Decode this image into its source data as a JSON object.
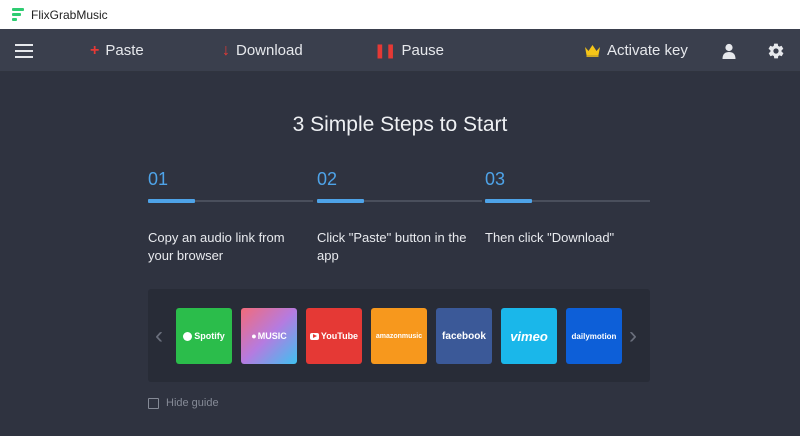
{
  "window": {
    "title": "FlixGrabMusic"
  },
  "toolbar": {
    "paste_label": "Paste",
    "download_label": "Download",
    "pause_label": "Pause",
    "activate_label": "Activate key"
  },
  "guide": {
    "heading": "3 Simple Steps to Start",
    "steps": [
      {
        "number": "01",
        "text": "Copy an audio link from your browser"
      },
      {
        "number": "02",
        "text": "Click \"Paste\" button in the app"
      },
      {
        "number": "03",
        "text": "Then click \"Download\""
      }
    ],
    "services": [
      {
        "name": "Spotify",
        "color": "#2bbd4b"
      },
      {
        "name": "MUSIC",
        "color": "#b57be0"
      },
      {
        "name": "YouTube",
        "color": "#e53935"
      },
      {
        "name": "amazonmusic",
        "color": "#f7981d"
      },
      {
        "name": "facebook",
        "color": "#3b5998"
      },
      {
        "name": "vimeo",
        "color": "#1ab7ea"
      },
      {
        "name": "dailymotion",
        "color": "#0d5fd8"
      }
    ],
    "hide_label": "Hide guide"
  },
  "icons": {
    "menu": "hamburger-icon",
    "paste": "plus-icon",
    "download": "arrow-down-icon",
    "pause": "pause-icon",
    "activate": "crown-icon",
    "user": "user-icon",
    "settings": "gear-icon"
  },
  "colors": {
    "accent": "#4ea3e8",
    "toolbar_icon_red": "#e53935",
    "crown": "#f5c518"
  }
}
